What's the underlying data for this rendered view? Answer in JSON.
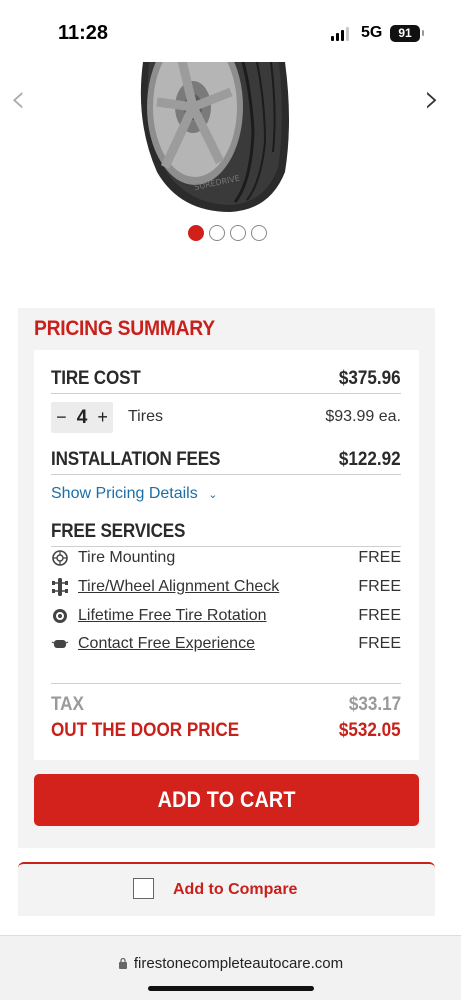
{
  "status_bar": {
    "time": "11:28",
    "network": "5G",
    "battery": "91"
  },
  "carousel": {
    "prev_icon": "chevron-left-icon",
    "next_icon": "chevron-right-icon",
    "slide_count": 4,
    "active_index": 0
  },
  "pricing": {
    "title": "PRICING SUMMARY",
    "tire_cost_label": "TIRE COST",
    "tire_cost_value": "$375.96",
    "decrement": "−",
    "quantity": "4",
    "increment": "+",
    "tires_label": "Tires",
    "each_price": "$93.99 ea.",
    "installation_label": "INSTALLATION FEES",
    "installation_value": "$122.92",
    "details_link": "Show Pricing Details",
    "free_services_label": "FREE SERVICES",
    "services": [
      {
        "name": "Tire Mounting",
        "value": "FREE",
        "icon": "tire-icon"
      },
      {
        "name": "Tire/Wheel Alignment Check",
        "value": "FREE",
        "icon": "alignment-icon"
      },
      {
        "name": "Lifetime Free Tire Rotation",
        "value": "FREE",
        "icon": "tire-rotation-icon"
      },
      {
        "name": "Contact Free Experience",
        "value": "FREE",
        "icon": "contact-free-icon"
      }
    ],
    "tax_label": "TAX",
    "tax_value": "$33.17",
    "otd_label": "OUT THE DOOR PRICE",
    "otd_value": "$532.05"
  },
  "cart_button": "ADD TO CART",
  "compare_label": "Add to Compare",
  "url": "firestonecompleteautocare.com",
  "colors": {
    "brand_red": "#d3211b",
    "link_blue": "#1a6fa8"
  }
}
